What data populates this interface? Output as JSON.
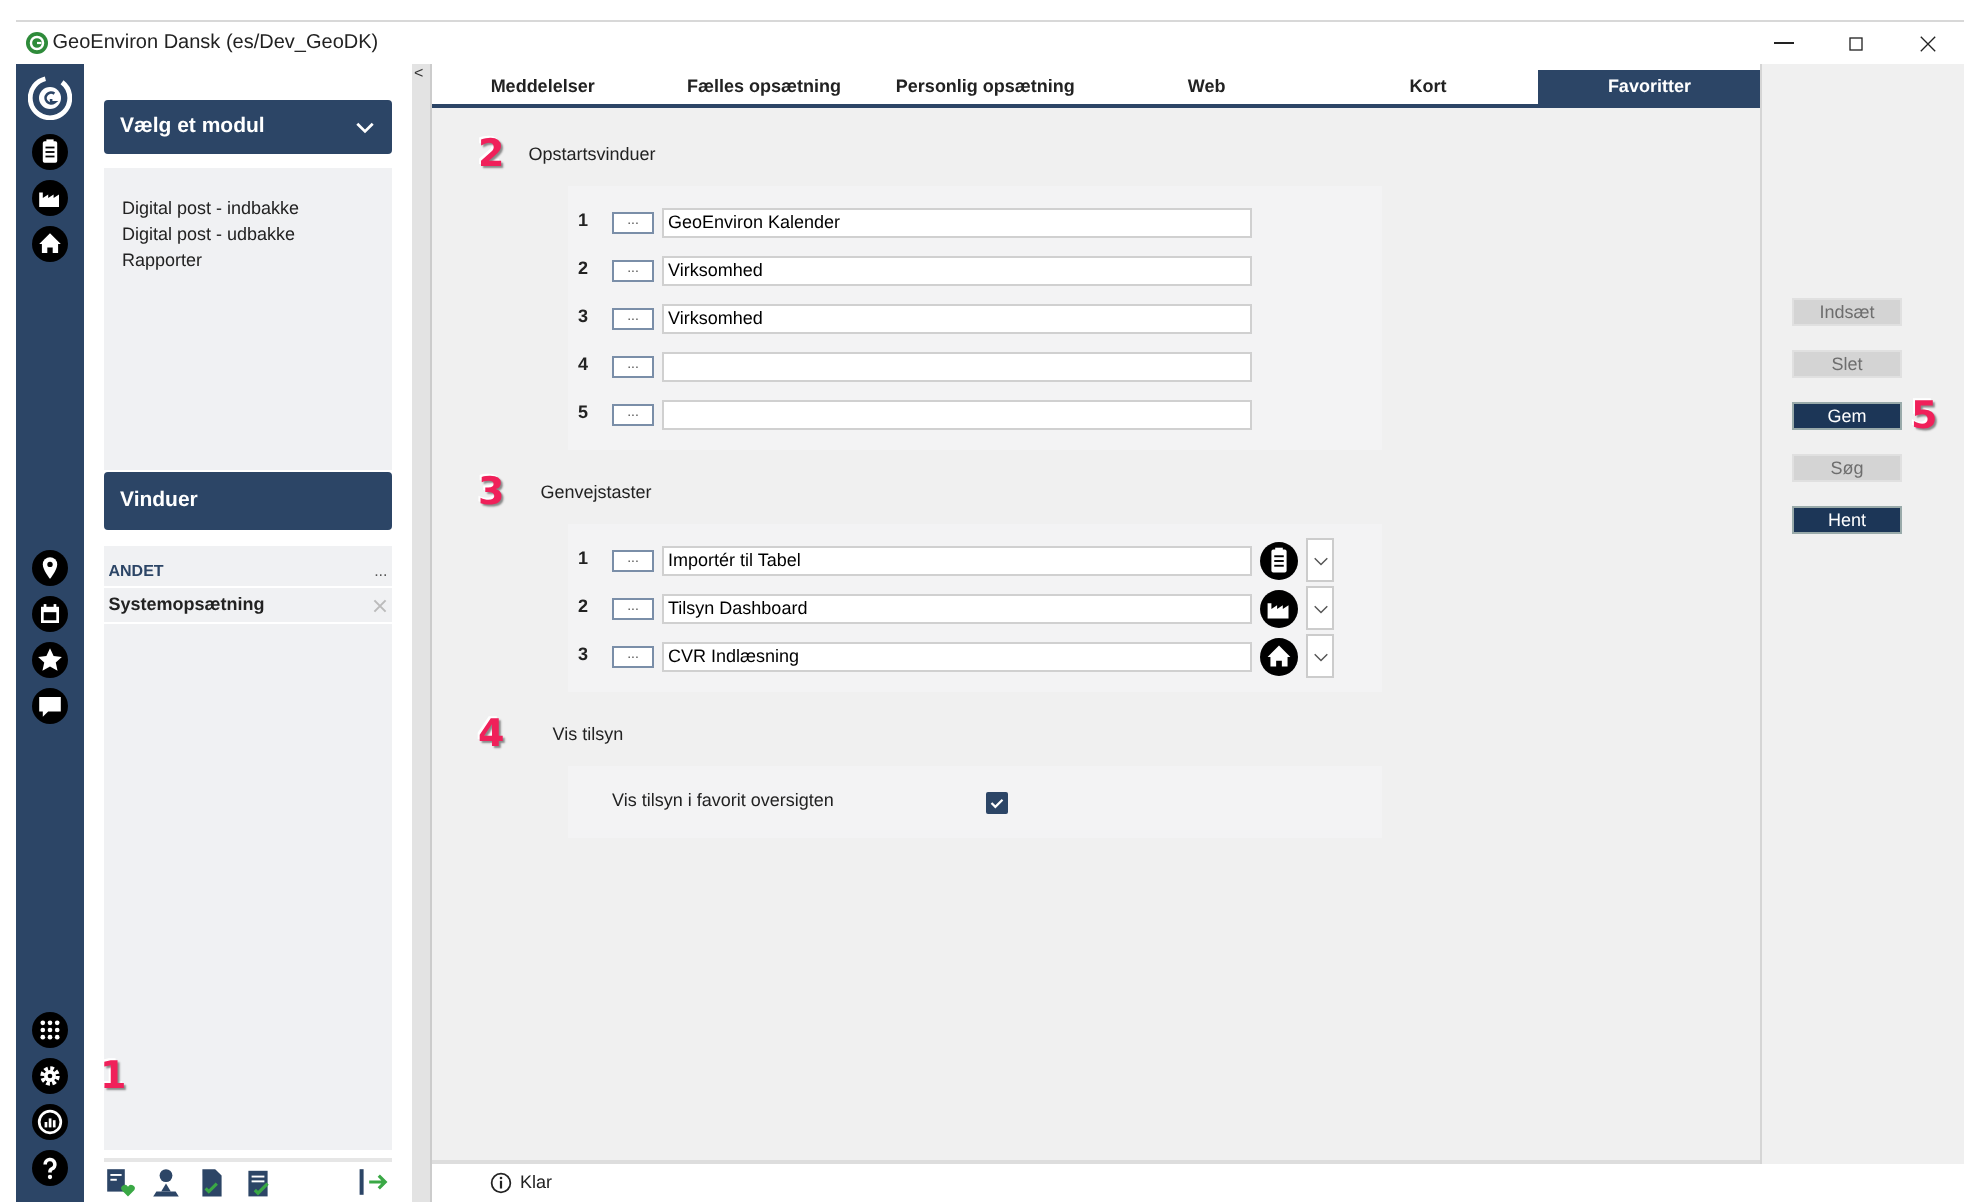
{
  "window": {
    "title": "GeoEnviron Dansk (es/Dev_GeoDK)"
  },
  "rail_marker": "1",
  "collapse_toggle": "<",
  "module_panel": {
    "title": "Vælg et modul",
    "items": [
      "Digital post - indbakke",
      "Digital post - udbakke",
      "Rapporter"
    ]
  },
  "windows_panel": {
    "title": "Vinduer",
    "group": "ANDET",
    "group_menu": "...",
    "items": [
      {
        "label": "Systemopsætning"
      }
    ]
  },
  "tabs": [
    {
      "label": "Meddelelser",
      "selected": false
    },
    {
      "label": "Fælles opsætning",
      "selected": false
    },
    {
      "label": "Personlig opsætning",
      "selected": false
    },
    {
      "label": "Web",
      "selected": false
    },
    {
      "label": "Kort",
      "selected": false
    },
    {
      "label": "Favoritter",
      "selected": true
    }
  ],
  "sections": [
    {
      "marker": "2",
      "title": "Opstartsvinduer",
      "kind": "slots",
      "rows": [
        {
          "number": "1",
          "button": "...",
          "value": "GeoEnviron Kalender"
        },
        {
          "number": "2",
          "button": "...",
          "value": "Virksomhed"
        },
        {
          "number": "3",
          "button": "...",
          "value": "Virksomhed"
        },
        {
          "number": "4",
          "button": "..."
        },
        {
          "number": "5",
          "button": "..."
        }
      ]
    },
    {
      "marker": "3",
      "title": "Genvejstaster",
      "kind": "shortcuts",
      "rows": [
        {
          "number": "1",
          "button": "...",
          "value": "Importér til Tabel"
        },
        {
          "number": "2",
          "button": "...",
          "value": "Tilsyn Dashboard"
        },
        {
          "number": "3",
          "button": "...",
          "value": "CVR Indlæsning"
        }
      ]
    },
    {
      "marker": "4",
      "title": "Vis tilsyn",
      "kind": "checks",
      "rows": [
        {
          "label": "Vis tilsyn i favorit oversigten",
          "checked": true
        }
      ]
    }
  ],
  "actions": {
    "marker": "5",
    "buttons": [
      {
        "label": "Indsæt",
        "disabled": true
      },
      {
        "label": "Slet",
        "disabled": true
      },
      {
        "label": "Gem",
        "disabled": false
      },
      {
        "label": "Søg",
        "disabled": true
      },
      {
        "label": "Hent",
        "disabled": false
      }
    ]
  },
  "status_bar": {
    "text": "Klar"
  }
}
